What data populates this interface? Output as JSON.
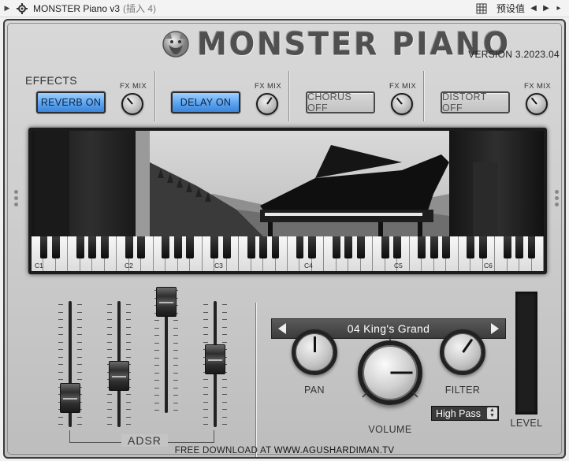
{
  "host": {
    "plugin_title": "MONSTER Piano v3",
    "plugin_sub": "(插入 4)",
    "preset_label": "预设值"
  },
  "header": {
    "logo_text": "MONSTER PIANO",
    "version": "VERSION 3.2023.04"
  },
  "effects": {
    "section_label": "EFFECTS",
    "fx_mix_label": "FX MIX",
    "slots": [
      {
        "label": "REVERB ON",
        "state": "on"
      },
      {
        "label": "DELAY ON",
        "state": "on"
      },
      {
        "label": "CHORUS OFF",
        "state": "off"
      },
      {
        "label": "DISTORT OFF",
        "state": "off"
      }
    ]
  },
  "keyboard": {
    "octave_labels": [
      "C1",
      "C2",
      "C3",
      "C4",
      "C5",
      "C6"
    ]
  },
  "adsr": {
    "label": "ADSR",
    "attack_level": 0.15,
    "decay_level": 0.38,
    "sustain_level": 1.0,
    "release_level": 0.55
  },
  "preset": {
    "name": "04 King's Grand"
  },
  "controls": {
    "pan_label": "PAN",
    "volume_label": "VOLUME",
    "filter_label": "FILTER",
    "level_label": "LEVEL",
    "filter_type": "High Pass"
  },
  "footer": {
    "prefix": "FREE DOWNLOAD AT",
    "url": "WWW.AGUSHARDIMAN.TV"
  },
  "colors": {
    "fx_on": "#5aa4f0",
    "panel_bg": "#cfcfcf",
    "dark": "#222222"
  }
}
